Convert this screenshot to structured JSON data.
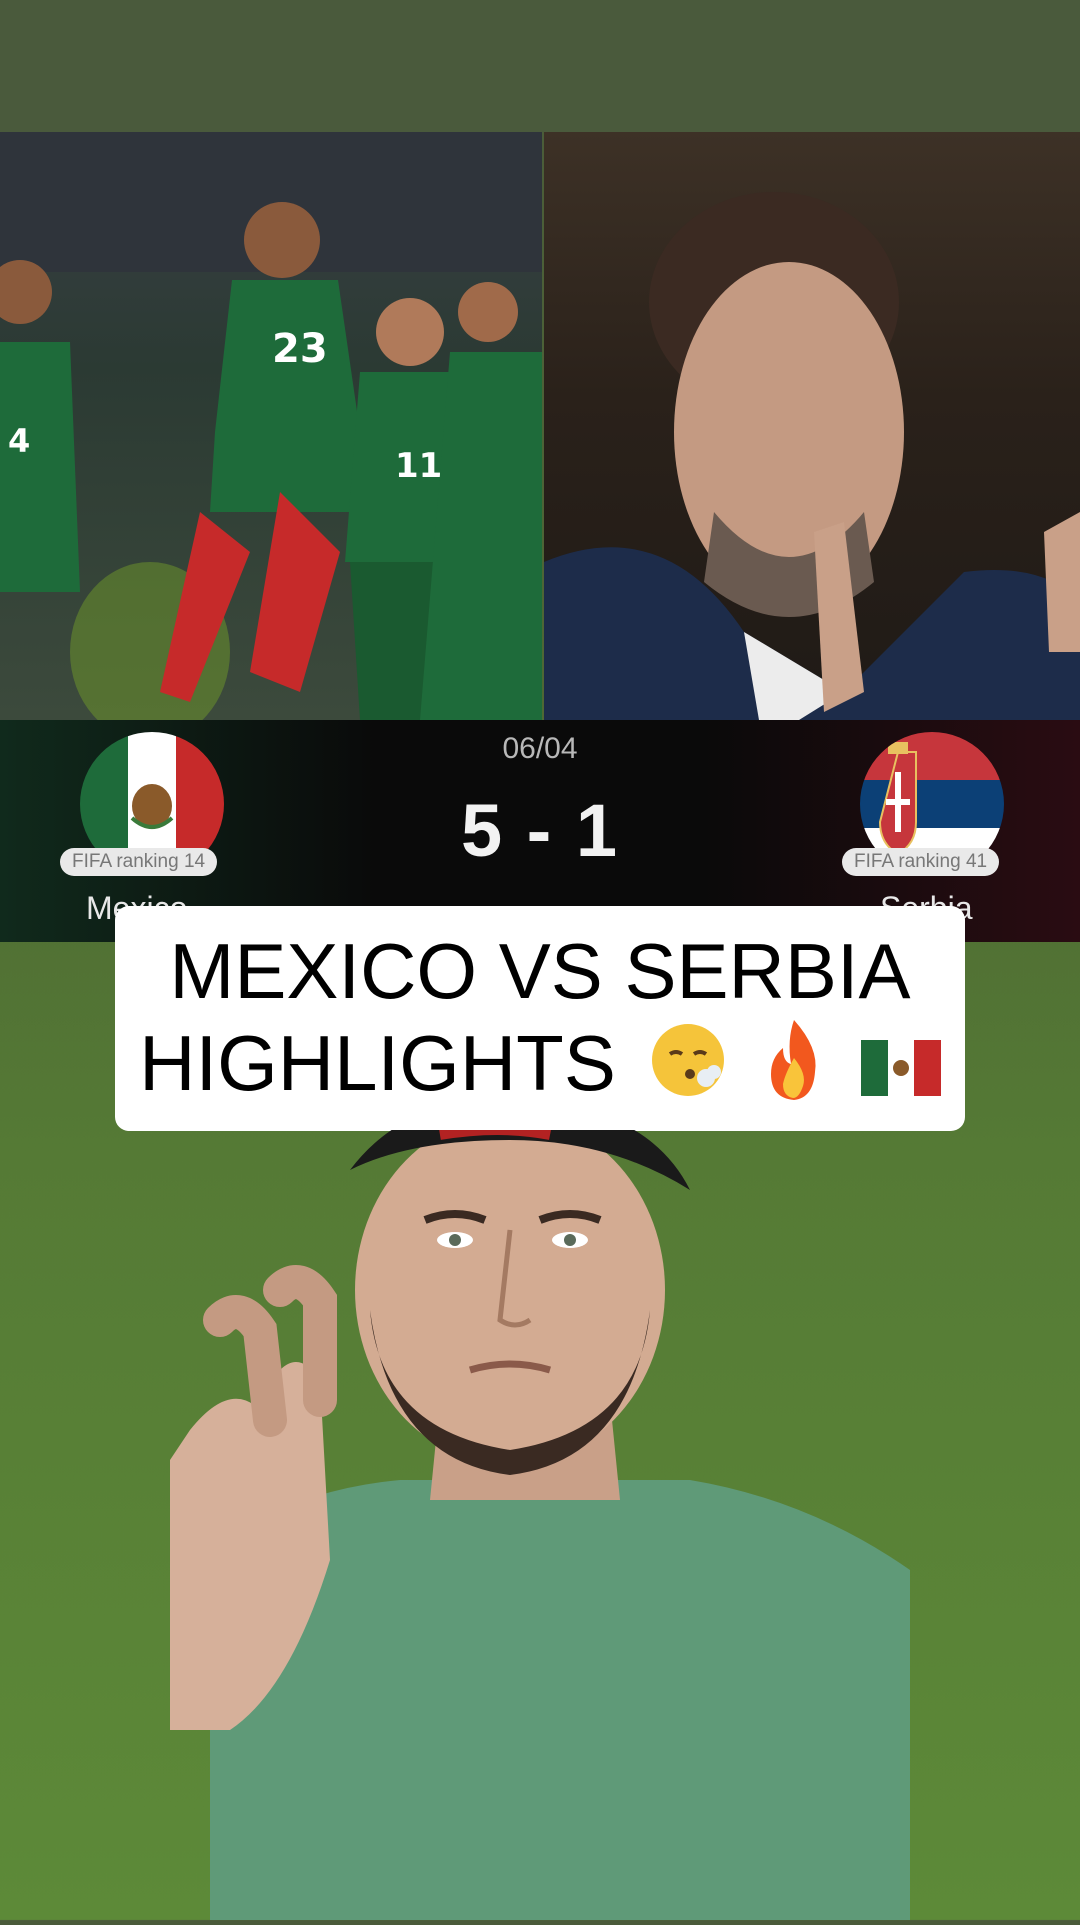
{
  "match": {
    "date": "06/04",
    "score": "5 - 1",
    "home_team": {
      "name": "Mexico",
      "ranking": "FIFA ranking 14",
      "flag": "mexico-flag"
    },
    "away_team": {
      "name": "Serbia",
      "ranking": "FIFA ranking 41",
      "flag": "serbia-flag"
    }
  },
  "caption": {
    "line1": "MEXICO VS SERBIA",
    "line2": "HIGHLIGHTS",
    "emojis": [
      "face-exhaling-icon",
      "fire-icon",
      "mexico-flag-icon"
    ]
  },
  "players": {
    "jersey_numbers": [
      "23",
      "11",
      "4"
    ]
  },
  "colors": {
    "mexico_green": "#1e6b3a",
    "mexico_red": "#c62a2a",
    "serbia_red": "#c6363c",
    "serbia_blue": "#0c4076",
    "background_green": "#5d8a38"
  }
}
